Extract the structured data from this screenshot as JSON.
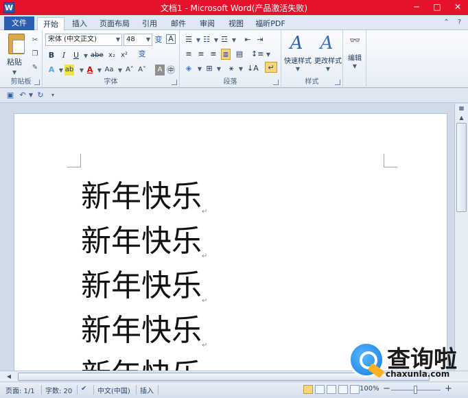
{
  "window": {
    "app_icon": "W",
    "title": "文档1 - Microsoft Word(产品激活失败)",
    "controls": [
      "─",
      "□",
      "✕"
    ]
  },
  "tabs": {
    "file": "文件",
    "items": [
      "开始",
      "插入",
      "页面布局",
      "引用",
      "邮件",
      "审阅",
      "视图",
      "福昕PDF"
    ],
    "active": "开始"
  },
  "ribbon": {
    "clipboard": {
      "label": "剪贴板",
      "paste": "粘贴"
    },
    "font": {
      "label": "字体",
      "font_name": "宋体 (中文正文)",
      "font_size": "48",
      "buttons": [
        "B",
        "I",
        "U",
        "abe",
        "x₂",
        "x²"
      ]
    },
    "paragraph": {
      "label": "段落"
    },
    "styles": {
      "label": "样式",
      "quick": "快速样式",
      "change": "更改样式"
    },
    "editing": {
      "label": "编辑"
    }
  },
  "document": {
    "lines": [
      "新年快乐",
      "新年快乐",
      "新年快乐",
      "新年快乐",
      "新年快乐"
    ],
    "paragraph_mark": "↵"
  },
  "statusbar": {
    "page": "页面: 1/1",
    "words": "字数: 20",
    "language": "中文(中国)",
    "mode": "插入",
    "zoom": "100%",
    "zoom_minus": "−",
    "zoom_plus": "+"
  },
  "watermark": {
    "brand": "查询啦",
    "url": "chaxunla.com"
  },
  "colors": {
    "titlebar": "#e8112b",
    "file_tab": "#2b5fb4",
    "ribbon_bg": "#f5f8fc",
    "workspace": "#cfdbe9"
  }
}
